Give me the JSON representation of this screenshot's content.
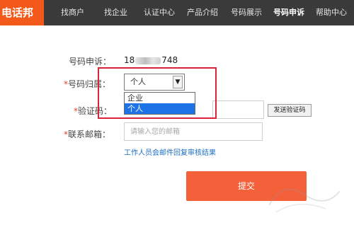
{
  "brand": "电话邦",
  "nav": {
    "items": [
      {
        "label": "找商户"
      },
      {
        "label": "找企业"
      },
      {
        "label": "认证中心"
      },
      {
        "label": "产品介绍"
      },
      {
        "label": "号码展示"
      },
      {
        "label": "号码申诉"
      },
      {
        "label": "帮助中心"
      }
    ],
    "active_index": 5
  },
  "form": {
    "phone": {
      "label": "号码申诉：",
      "prefix": "18",
      "suffix": "748"
    },
    "ownership": {
      "required_mark": "*",
      "label": "号码归属：",
      "selected": "个人",
      "options": [
        {
          "label": "企业"
        },
        {
          "label": "个人"
        }
      ],
      "highlighted_option": "个人"
    },
    "captcha": {
      "required_mark": "*",
      "label": "验证码：",
      "value": "",
      "send_button": "发送验证码"
    },
    "email": {
      "required_mark": "*",
      "label": "联系邮箱：",
      "placeholder": "请输入您的邮箱"
    },
    "notice_link": "工作人员会邮件回复审核结果",
    "submit_label": "提交"
  },
  "colors": {
    "brand": "#f2591b",
    "nav_bg": "#3a3a3a",
    "submit": "#f3603a",
    "highlight": "#d9233a",
    "link": "#1b6ec2",
    "option_selected": "#1e74e6"
  }
}
